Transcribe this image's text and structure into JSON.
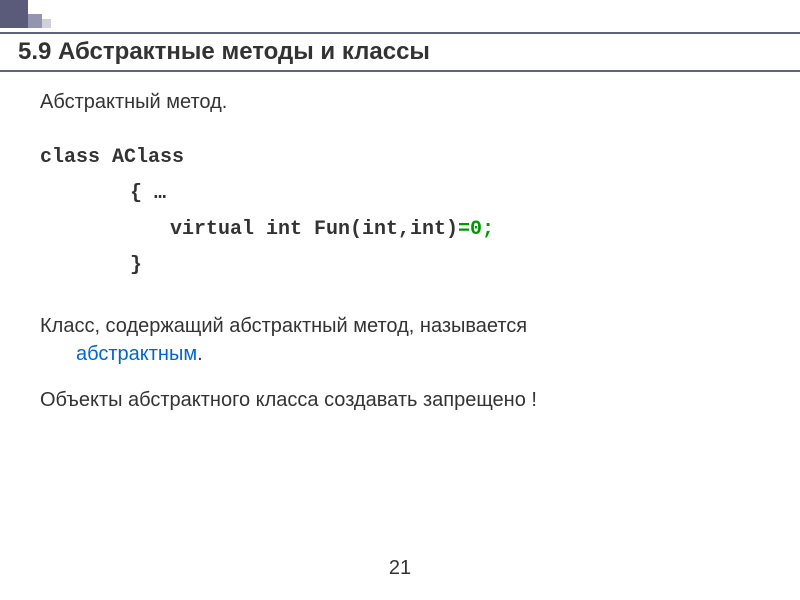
{
  "title": "5.9 Абстрактные методы и классы",
  "subtitle": "Абстрактный метод.",
  "code": {
    "line1": "class AClass",
    "line2": "{ …",
    "line3a": "virtual int Fun(int,int)",
    "line3b": "=0;",
    "line4": "}"
  },
  "para1": {
    "part1": "Класс, содержащий абстрактный метод, называется ",
    "highlight": "абстрактным",
    "part2": "."
  },
  "para2": "Объекты абстрактного класса создавать запрещено !",
  "pageNumber": "21",
  "colors": {
    "titleBorder": "#606080",
    "codeGreen": "#009900",
    "linkBlue": "#0066cc"
  }
}
